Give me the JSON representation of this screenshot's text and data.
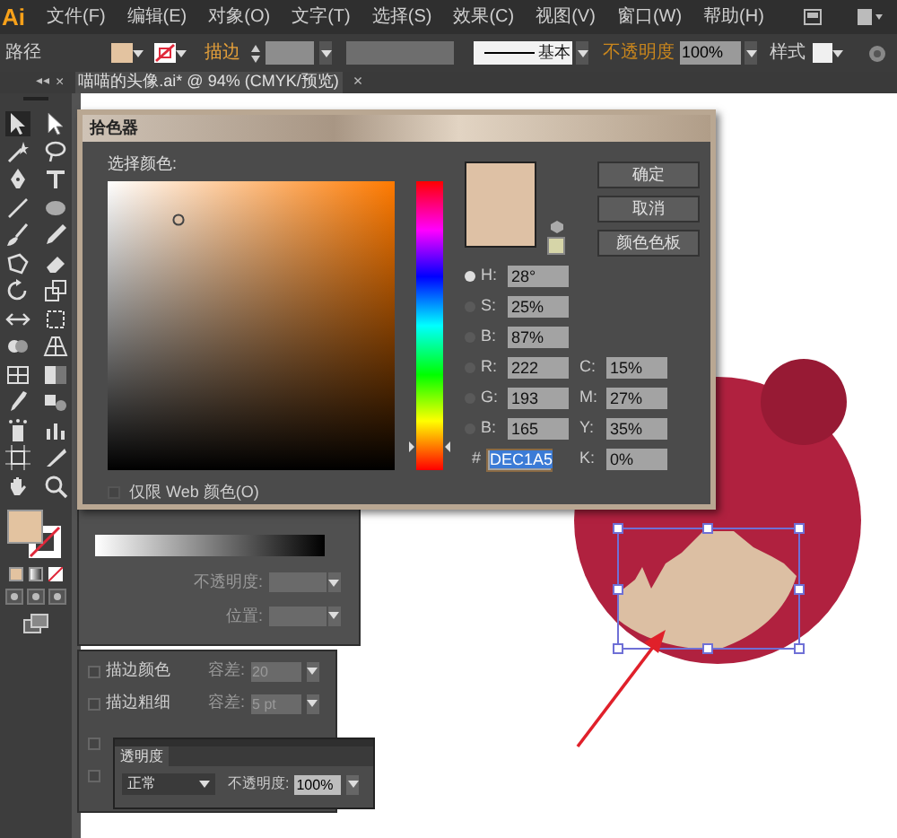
{
  "menu_bar": {
    "logo": "Ai",
    "items": [
      "文件(F)",
      "编辑(E)",
      "对象(O)",
      "文字(T)",
      "选择(S)",
      "效果(C)",
      "视图(V)",
      "窗口(W)",
      "帮助(H)"
    ]
  },
  "control_bar": {
    "object_type": "路径",
    "stroke_label": "描边",
    "profile": "基本",
    "opacity_label": "不透明度",
    "opacity": "100%",
    "style_label": "样式"
  },
  "toolbar_header": {
    "collapse": "◂◂",
    "close": "×"
  },
  "document_tab": {
    "title": "喵喵的头像.ai* @ 94% (CMYK/预览)",
    "close": "×"
  },
  "color_picker": {
    "title": "拾色器",
    "prompt": "选择颜色:",
    "buttons": [
      "确定",
      "取消",
      "颜色色板"
    ],
    "hsb_rgb": [
      {
        "label": "H:",
        "value": "28°",
        "selected": true
      },
      {
        "label": "S:",
        "value": "25%",
        "selected": false
      },
      {
        "label": "B:",
        "value": "87%",
        "selected": false
      },
      {
        "label": "R:",
        "value": "222",
        "selected": false
      },
      {
        "label": "G:",
        "value": "193",
        "selected": false
      },
      {
        "label": "B:",
        "value": "165",
        "selected": false
      }
    ],
    "cmyk": [
      {
        "label": "C:",
        "value": "15%"
      },
      {
        "label": "M:",
        "value": "27%"
      },
      {
        "label": "Y:",
        "value": "35%"
      },
      {
        "label": "K:",
        "value": "0%"
      }
    ],
    "hue_slider": {
      "level": 0.08
    },
    "hex_label": "#",
    "hex": "DEC1A5",
    "web_only": {
      "label": "仅限 Web 颜色(O)",
      "checked": false
    }
  },
  "gradient_panel": {
    "fields": [
      {
        "label": "不透明度:"
      },
      {
        "label": "位置:"
      }
    ]
  },
  "attributes_panel": {
    "rows": [
      {
        "label": "描边颜色",
        "checked": false,
        "tolerance_label": "容差:",
        "tolerance": "20"
      },
      {
        "label": "描边粗细",
        "checked": false,
        "tolerance_label": "容差:",
        "tolerance": "5 pt"
      },
      {
        "checked": false
      },
      {
        "checked": false
      }
    ]
  },
  "transparency_panel": {
    "tab": "透明度",
    "blend_mode": "正常",
    "opacity_label": "不透明度:",
    "opacity": "100%"
  }
}
